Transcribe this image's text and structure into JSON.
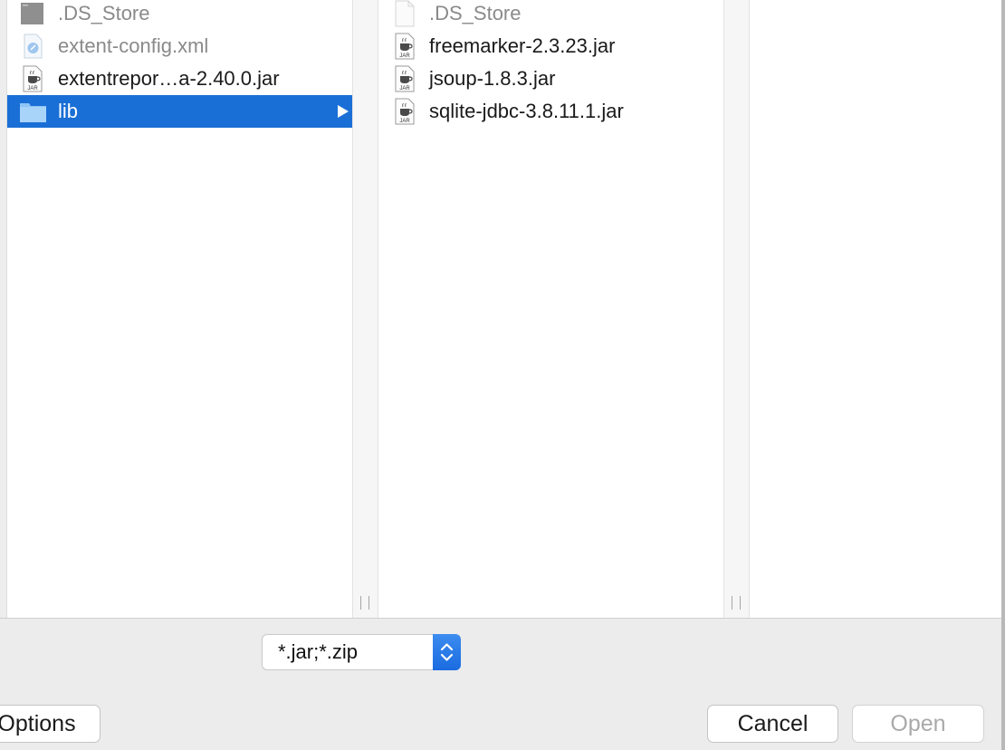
{
  "column1": {
    "items": [
      {
        "label": ".DS_Store",
        "icon": "ds-store-file-icon",
        "dim": true
      },
      {
        "label": "extent-config.xml",
        "icon": "xml-file-icon",
        "dim": true
      },
      {
        "label": "extentrepor…a-2.40.0.jar",
        "icon": "jar-file-icon",
        "dim": false
      },
      {
        "label": "lib",
        "icon": "folder-icon",
        "dim": false,
        "selected": true
      }
    ]
  },
  "column2": {
    "items": [
      {
        "label": ".DS_Store",
        "icon": "blank-file-icon",
        "dim": true
      },
      {
        "label": "freemarker-2.3.23.jar",
        "icon": "jar-file-icon",
        "dim": false
      },
      {
        "label": "jsoup-1.8.3.jar",
        "icon": "jar-file-icon",
        "dim": false
      },
      {
        "label": "sqlite-jdbc-3.8.11.1.jar",
        "icon": "jar-file-icon",
        "dim": false
      }
    ]
  },
  "filter": {
    "value": "*.jar;*.zip"
  },
  "buttons": {
    "options": "Options",
    "cancel": "Cancel",
    "open": "Open"
  },
  "colors": {
    "selection": "#1a6fd6",
    "accent": "#2f7fe8"
  }
}
